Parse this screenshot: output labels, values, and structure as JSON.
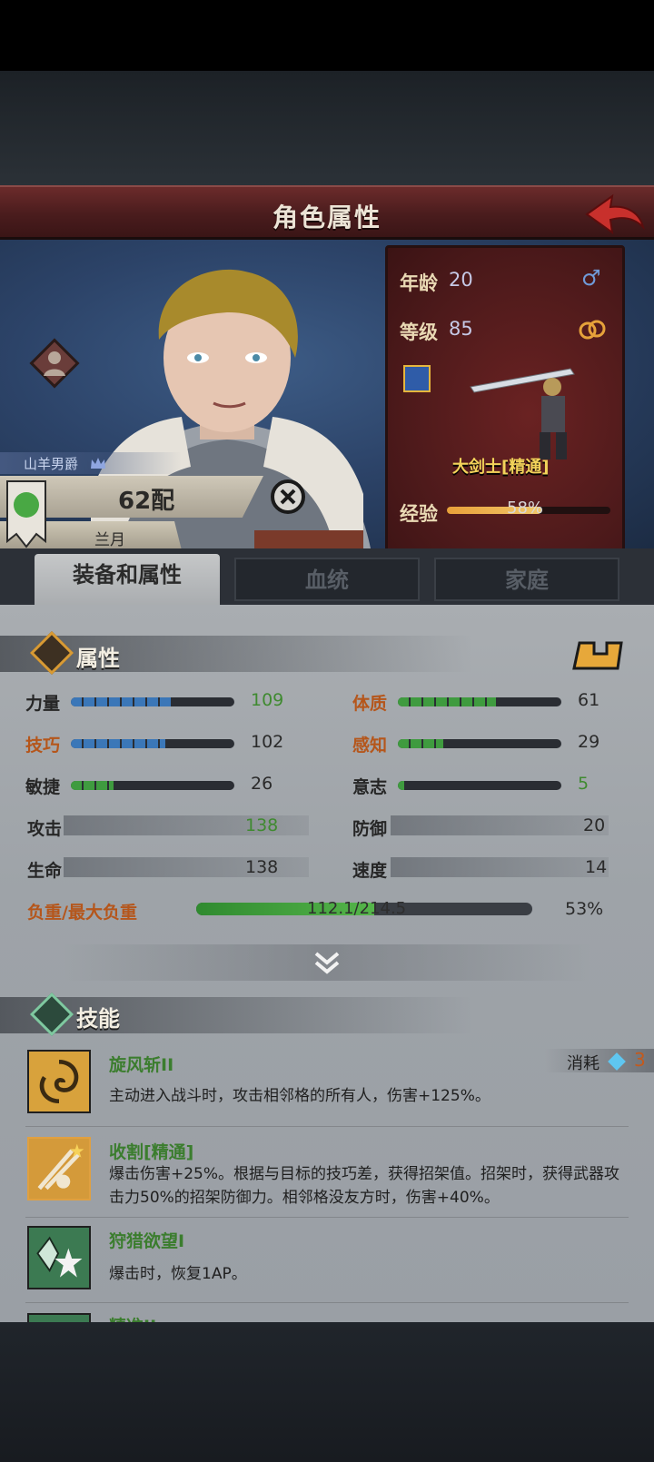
{
  "header": {
    "title": "角色属性"
  },
  "portrait": {
    "noble_title": "山羊男爵",
    "name": "62配",
    "spouse": "兰月"
  },
  "info": {
    "age_label": "年龄",
    "age_value": "20",
    "level_label": "等级",
    "level_value": "85",
    "class_name": "大剑士[精通]",
    "xp_label": "经验",
    "xp_percent": "58%",
    "xp_fraction": 0.58
  },
  "tabs": [
    {
      "label": "装备和属性",
      "active": true
    },
    {
      "label": "血统",
      "active": false
    },
    {
      "label": "家庭",
      "active": false
    }
  ],
  "attributes": {
    "title": "属性",
    "stats": [
      {
        "label": "力量",
        "value": "109",
        "fill": 0.62,
        "color": "blue"
      },
      {
        "label": "体质",
        "value": "61",
        "fill": 0.6,
        "color": "green"
      },
      {
        "label": "技巧",
        "value": "102",
        "fill": 0.58,
        "color": "blue"
      },
      {
        "label": "感知",
        "value": "29",
        "fill": 0.28,
        "color": "green"
      },
      {
        "label": "敏捷",
        "value": "26",
        "fill": 0.26,
        "color": "green"
      },
      {
        "label": "意志",
        "value": "5",
        "fill": 0.04,
        "color": "green"
      }
    ],
    "combat": [
      {
        "label": "攻击",
        "value": "138"
      },
      {
        "label": "防御",
        "value": "20"
      },
      {
        "label": "生命",
        "value": "138"
      },
      {
        "label": "速度",
        "value": "14"
      }
    ],
    "load_label": "负重/最大负重",
    "load_value": "112.1/214.5",
    "load_percent": "53%",
    "load_fraction": 0.53
  },
  "skills": {
    "title": "技能",
    "cost_label": "消耗",
    "cost_value": "3",
    "items": [
      {
        "name": "旋风斩II",
        "desc": "主动进入战斗时，攻击相邻格的所有人，伤害+125%。"
      },
      {
        "name": "收割[精通]",
        "desc": "爆击伤害+25%。根据与目标的技巧差，获得招架值。招架时，获得武器攻击力50%的招架防御力。相邻格没友方时，伤害+40%。"
      },
      {
        "name": "狩猎欲望I",
        "desc": "爆击时，恢复1AP。"
      },
      {
        "name": "精准II",
        "desc": ""
      }
    ]
  },
  "colors": {
    "header_red": "#5a2324",
    "panel_gray": "#a4a8ad",
    "skill_green": "#3b7d2e",
    "accent_orange": "#b5561b",
    "class_gold": "#f2d35a"
  }
}
